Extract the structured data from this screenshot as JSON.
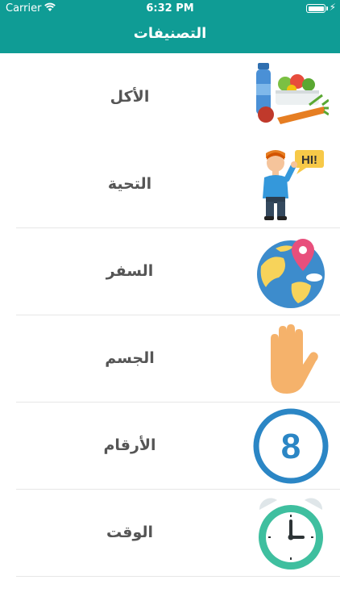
{
  "status": {
    "carrier": "Carrier",
    "time": "6:32 PM"
  },
  "header": {
    "title": "التصنيفات"
  },
  "categories": [
    {
      "label": "الأكل",
      "icon": "food-icon"
    },
    {
      "label": "التحية",
      "icon": "greeting-man-icon",
      "bubble": "HI!"
    },
    {
      "label": "السفر",
      "icon": "globe-location-icon"
    },
    {
      "label": "الجسم",
      "icon": "hand-icon"
    },
    {
      "label": "الأرقام",
      "icon": "number-eight-icon",
      "number": "8"
    },
    {
      "label": "الوقت",
      "icon": "alarm-clock-icon"
    }
  ],
  "colors": {
    "header": "#0f9c95",
    "label": "#555555",
    "separator": "#e6e6e6"
  }
}
